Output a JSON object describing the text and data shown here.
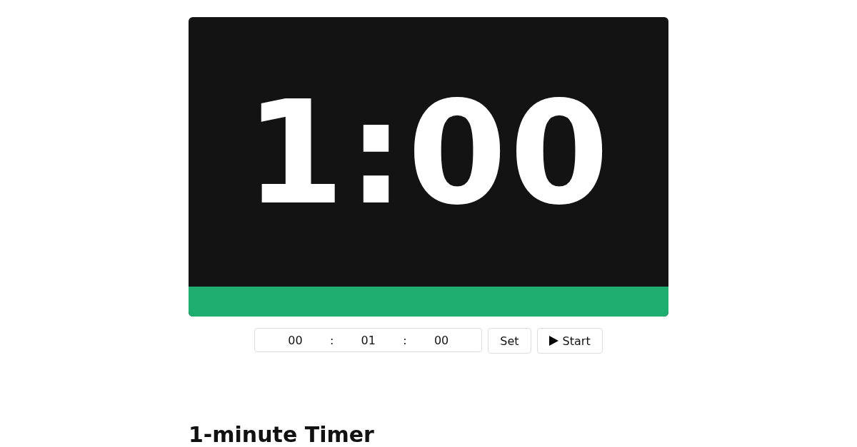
{
  "timer": {
    "display": "1:00",
    "progress": {
      "level": 1
    }
  },
  "controls": {
    "fields": [
      {
        "value": "00"
      },
      {
        "value": "01"
      },
      {
        "value": "00"
      }
    ],
    "separators": [
      ":",
      ":"
    ],
    "set_button": "Set",
    "start_button": "Start"
  },
  "heading": "1-minute Timer"
}
